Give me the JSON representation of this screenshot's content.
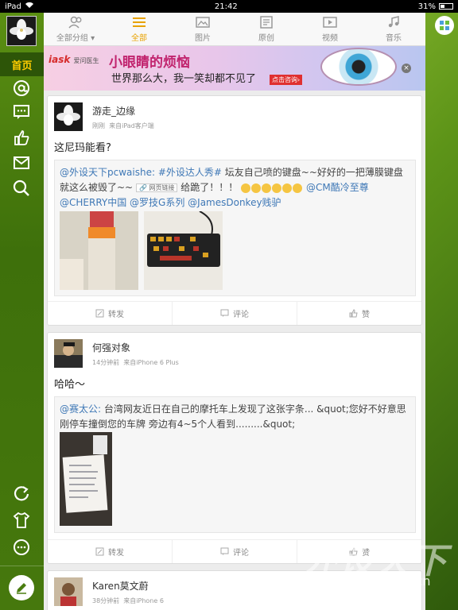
{
  "status_bar": {
    "device": "iPad",
    "time": "21:42",
    "battery": "31%",
    "battery_level": 0.31
  },
  "sidebar": {
    "home_label": "首页",
    "icons": [
      "at-icon",
      "message-icon",
      "like-icon",
      "mail-icon",
      "search-icon",
      "refresh-icon",
      "tshirt-icon",
      "more-icon",
      "compose-icon"
    ]
  },
  "tabs": [
    {
      "label": "全部分组 ▾",
      "icon": "group-icon"
    },
    {
      "label": "全部",
      "icon": "list-icon",
      "active": true
    },
    {
      "label": "图片",
      "icon": "image-icon"
    },
    {
      "label": "原创",
      "icon": "document-icon"
    },
    {
      "label": "视频",
      "icon": "video-icon"
    },
    {
      "label": "音乐",
      "icon": "music-icon"
    }
  ],
  "banner": {
    "logo": "iask",
    "logo_sub": "爱问医生",
    "headline": "小眼睛的烦恼",
    "subline": "世界那么大，我一笑却都不见了",
    "cta": "点击咨询›"
  },
  "posts": [
    {
      "author": "游走_边缘",
      "time": "刚刚",
      "source": "来自iPad客户端",
      "text": "这尼玛能看?",
      "quote": {
        "mention": "@外设天下pcwaishe:",
        "tag": "#外设达人秀#",
        "body": "坛友自己喷的键盘~~好好的一把薄膜键盘就这么被毁了~~",
        "chip": "网页链接",
        "body2": "给跪了！！！",
        "mentions2": "@CM酷冷至尊 @CHERRY中国 @罗技G系列 @JamesDonkey贱驴"
      },
      "actions": {
        "repost": "转发",
        "comment": "评论",
        "like": "赞"
      }
    },
    {
      "author": "何强对象",
      "time": "14分钟前",
      "source": "来自iPhone 6 Plus",
      "text": "哈哈～",
      "quote": {
        "mention": "@赛太公:",
        "body": "台湾网友近日在自己的摩托车上发现了这张字条... &quot;您好不好意思 刚停车撞倒您的车牌 旁边有4~5个人看到.........&quot;"
      },
      "actions": {
        "repost": "转发",
        "comment": "评论",
        "like": "赞"
      }
    },
    {
      "author": "Karen莫文蔚",
      "time": "38分钟前",
      "source": "来自iPhone 6"
    }
  ],
  "watermark": {
    "brand": "外设天下",
    "url": "www.pcwaishe.cn"
  },
  "colors": {
    "accent": "#e8a200",
    "link": "#3f78b6",
    "sidebar": "#46780d",
    "home_text": "#ffcc00"
  }
}
